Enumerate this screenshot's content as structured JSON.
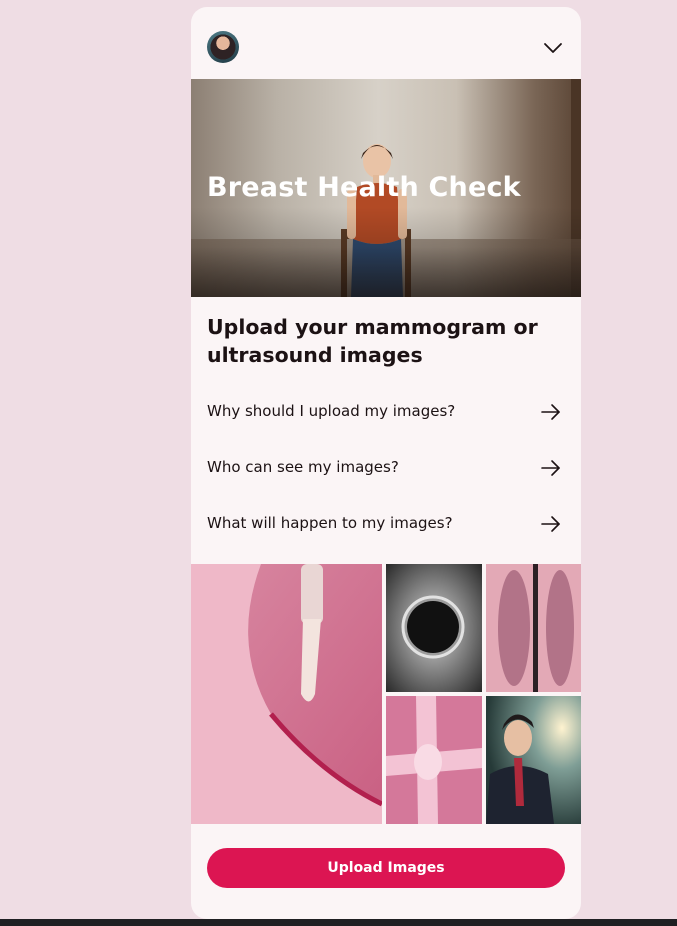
{
  "header": {
    "avatar_icon": "user-avatar",
    "menu_icon": "chevron-down-icon"
  },
  "hero": {
    "title": "Breast Health Check"
  },
  "main": {
    "heading": "Upload your mammogram or ultrasound images",
    "faq": [
      {
        "label": "Why should I upload my images?",
        "icon": "arrow-right-icon"
      },
      {
        "label": "Who can see my images?",
        "icon": "arrow-right-icon"
      },
      {
        "label": "What will happen to my images?",
        "icon": "arrow-right-icon"
      }
    ]
  },
  "gallery": {
    "images": [
      "pink-tissue-probe",
      "circular-scan",
      "ultrasound-strips",
      "pink-bone-xray",
      "man-in-suit"
    ]
  },
  "footer": {
    "upload_label": "Upload Images"
  },
  "colors": {
    "background": "#efdde4",
    "card": "#fbf5f6",
    "accent": "#dc1552",
    "text": "#1c1214"
  }
}
